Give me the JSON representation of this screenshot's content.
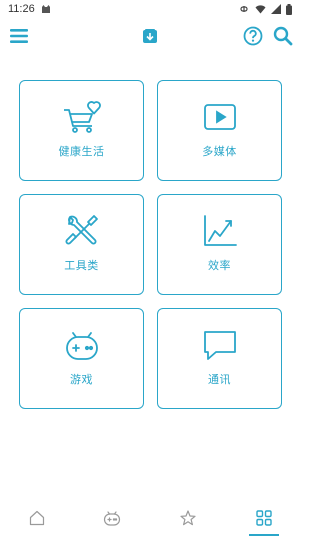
{
  "status_bar": {
    "time": "11:26",
    "icons": [
      "cat-notification-icon",
      "link-icon",
      "wifi-icon",
      "signal-icon",
      "battery-icon"
    ]
  },
  "app_bar": {
    "menu_icon": "menu-icon",
    "logo_icon": "app-logo-icon",
    "help_icon": "help-icon",
    "search_icon": "search-icon"
  },
  "categories": [
    {
      "label": "健康生活",
      "icon": "shopping-cart-heart-icon"
    },
    {
      "label": "多媒体",
      "icon": "play-icon"
    },
    {
      "label": "工具类",
      "icon": "tools-icon"
    },
    {
      "label": "效率",
      "icon": "trend-chart-icon"
    },
    {
      "label": "游戏",
      "icon": "gamepad-icon"
    },
    {
      "label": "通讯",
      "icon": "chat-bubble-icon"
    }
  ],
  "bottom_nav": {
    "items": [
      "home-icon",
      "game-controller-icon",
      "star-icon",
      "apps-grid-icon"
    ],
    "active": "apps-grid-icon"
  },
  "colors": {
    "accent": "#2aa6c9",
    "background": "#ffffff"
  }
}
